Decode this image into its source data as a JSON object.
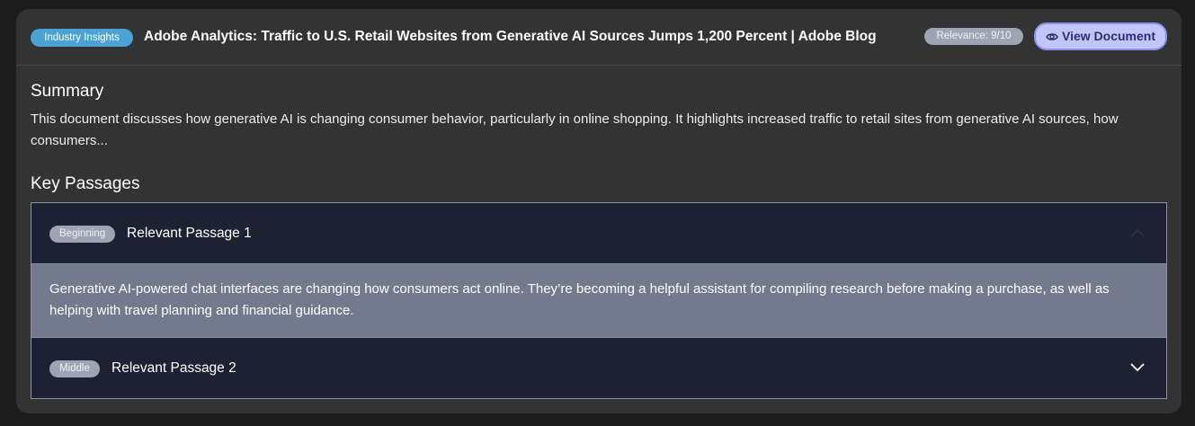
{
  "document": {
    "category": "Industry Insights",
    "title": "Adobe Analytics: Traffic to U.S. Retail Websites from Generative AI Sources Jumps 1,200 Percent | Adobe Blog",
    "relevance": "Relevance: 9/10",
    "view_button_label": "View Document",
    "view_button_icon": "eye-icon"
  },
  "summary": {
    "heading": "Summary",
    "text": "This document discusses how generative AI is changing consumer behavior, particularly in online shopping. It highlights increased traffic to retail sites from generative AI sources, how consumers..."
  },
  "key_passages": {
    "heading": "Key Passages",
    "items": [
      {
        "position": "Beginning",
        "title": "Relevant Passage 1",
        "expanded": true,
        "text": "Generative AI-powered chat interfaces are changing how consumers act online. They’re becoming a helpful assistant for compiling research before making a purchase, as well as helping with travel planning and financial guidance."
      },
      {
        "position": "Middle",
        "title": "Relevant Passage 2",
        "expanded": false
      }
    ]
  },
  "colors": {
    "card_bg": "#333333",
    "category_badge": "#4aa3d4",
    "view_button_bg": "#c1c6fa",
    "accordion_bg": "#1d2233",
    "expanded_body_bg": "#747a8d"
  }
}
